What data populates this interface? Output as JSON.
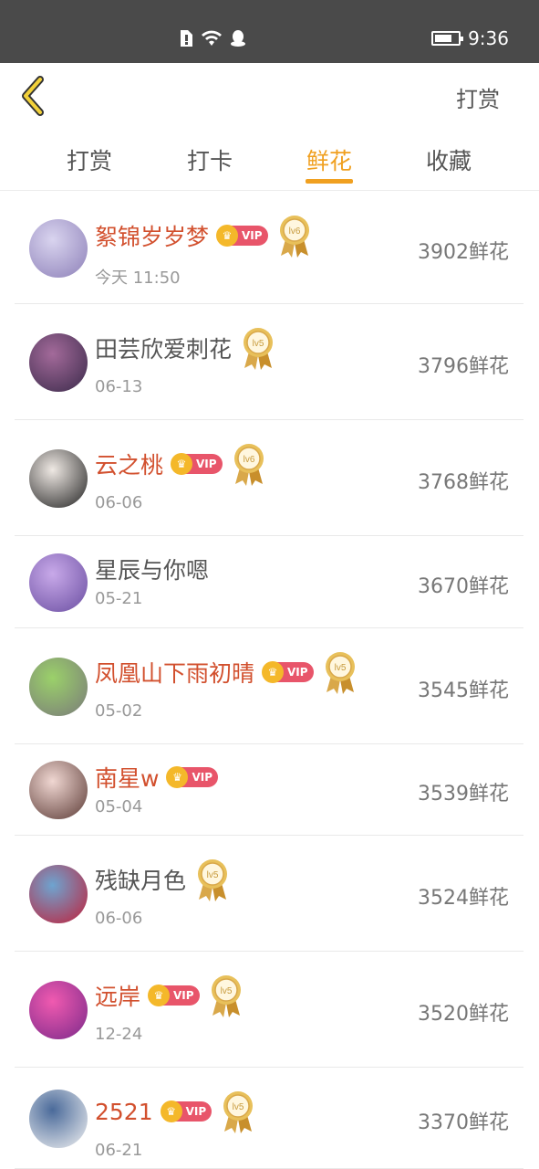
{
  "status_bar": {
    "time": "9:36",
    "battery_level": 0.75,
    "icons": [
      "sim-alert-icon",
      "wifi-icon",
      "qq-icon"
    ]
  },
  "header": {
    "back_icon": "chevron-left-icon",
    "action": "打赏"
  },
  "tabs": [
    {
      "label": "打赏",
      "active": false
    },
    {
      "label": "打卡",
      "active": false
    },
    {
      "label": "鲜花",
      "active": true
    },
    {
      "label": "收藏",
      "active": false
    }
  ],
  "colors": {
    "accent": "#f0a020",
    "vip_name": "#d2502e",
    "vip_badge": "#e8556a"
  },
  "badges": {
    "vip_label": "VIP",
    "lv5": "lv5",
    "lv6": "lv6"
  },
  "rows": [
    {
      "name": "絮锦岁岁梦",
      "vip": true,
      "level": "lv6",
      "date": "今天 11:50",
      "amount": "3902鲜花",
      "avatar_colors": [
        "#d9d4ef",
        "#8d80b8"
      ]
    },
    {
      "name": "田芸欣爱刺花",
      "vip": false,
      "level": "lv5",
      "date": "06-13",
      "amount": "3796鲜花",
      "avatar_colors": [
        "#a36a9a",
        "#3a2a4a"
      ]
    },
    {
      "name": "云之桃",
      "vip": true,
      "level": "lv6",
      "date": "06-06",
      "amount": "3768鲜花",
      "avatar_colors": [
        "#efe9e4",
        "#222222"
      ]
    },
    {
      "name": "星辰与你嗯",
      "vip": false,
      "level": "",
      "date": "05-21",
      "amount": "3670鲜花",
      "avatar_colors": [
        "#c8a9e9",
        "#6a4ea1"
      ]
    },
    {
      "name": "凤凰山下雨初晴",
      "vip": true,
      "level": "lv5",
      "date": "05-02",
      "amount": "3545鲜花",
      "avatar_colors": [
        "#9bd16a",
        "#7a7a7a"
      ]
    },
    {
      "name": "南星w",
      "vip": true,
      "level": "",
      "date": "05-04",
      "amount": "3539鲜花",
      "avatar_colors": [
        "#f0d7d2",
        "#5b3a35"
      ]
    },
    {
      "name": "残缺月色",
      "vip": false,
      "level": "lv5",
      "date": "06-06",
      "amount": "3524鲜花",
      "avatar_colors": [
        "#6ea4d0",
        "#c0203a"
      ]
    },
    {
      "name": "远岸",
      "vip": true,
      "level": "lv5",
      "date": "12-24",
      "amount": "3520鲜花",
      "avatar_colors": [
        "#f05ab0",
        "#7b2a8a"
      ]
    },
    {
      "name": "2521",
      "vip": true,
      "level": "lv5",
      "date": "06-21",
      "amount": "3370鲜花",
      "avatar_colors": [
        "#4a6a9a",
        "#f2f2f2"
      ]
    }
  ]
}
